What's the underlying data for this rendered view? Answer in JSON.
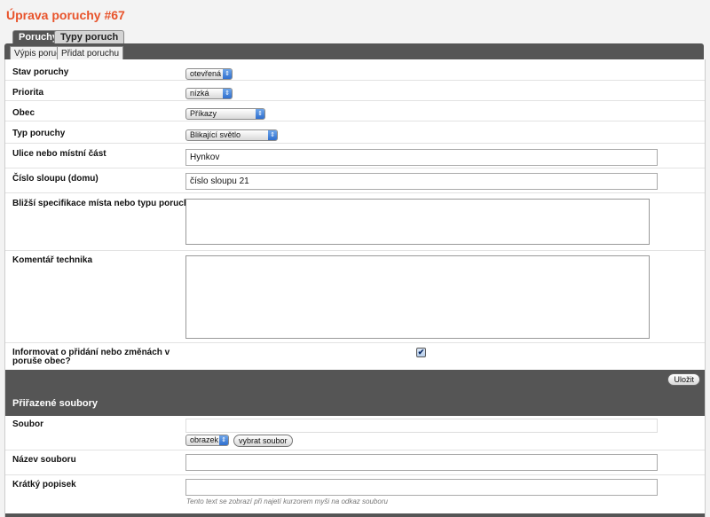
{
  "page_title": "Úprava poruchy #67",
  "tabs": [
    {
      "label": "Poruchy"
    },
    {
      "label": "Typy poruch"
    }
  ],
  "subtabs": [
    {
      "label": "Výpis poruch"
    },
    {
      "label": "Přidat poruchu"
    }
  ],
  "form": {
    "status": {
      "label": "Stav poruchy",
      "value": "otevřená"
    },
    "priority": {
      "label": "Priorita",
      "value": "nízká"
    },
    "municipality": {
      "label": "Obec",
      "value": "Příkazy"
    },
    "fault_type": {
      "label": "Typ poruchy",
      "value": "Blikající světlo"
    },
    "street": {
      "label": "Ulice nebo místní část",
      "value": "Hynkov"
    },
    "pole_number": {
      "label": "Číslo sloupu (domu)",
      "value": "číslo sloupu 21"
    },
    "details": {
      "label": "Bližší specifikace místa nebo typu poruchy",
      "value": ""
    },
    "technician_comment": {
      "label": "Komentář technika",
      "value": ""
    },
    "notify": {
      "label": "Informovat o přidání nebo změnách v poruše obec?",
      "checked": true,
      "check_glyph": "✔"
    },
    "save_label": "Uložit"
  },
  "files": {
    "section_title": "Přiřazené soubory",
    "file": {
      "label": "Soubor",
      "type_value": "obrazek",
      "choose_label": "vybrat soubor"
    },
    "file_name": {
      "label": "Název souboru",
      "value": ""
    },
    "short_desc": {
      "label": "Krátký popisek",
      "value": "",
      "hint": "Tento text se zobrazí při najetí kurzorem myši na odkaz souboru"
    }
  },
  "icons": {
    "select_arrow": "updown-arrows-icon"
  },
  "colors": {
    "title": "#e8532b",
    "dark": "#555555",
    "select_arrow": "#2f6fce"
  }
}
